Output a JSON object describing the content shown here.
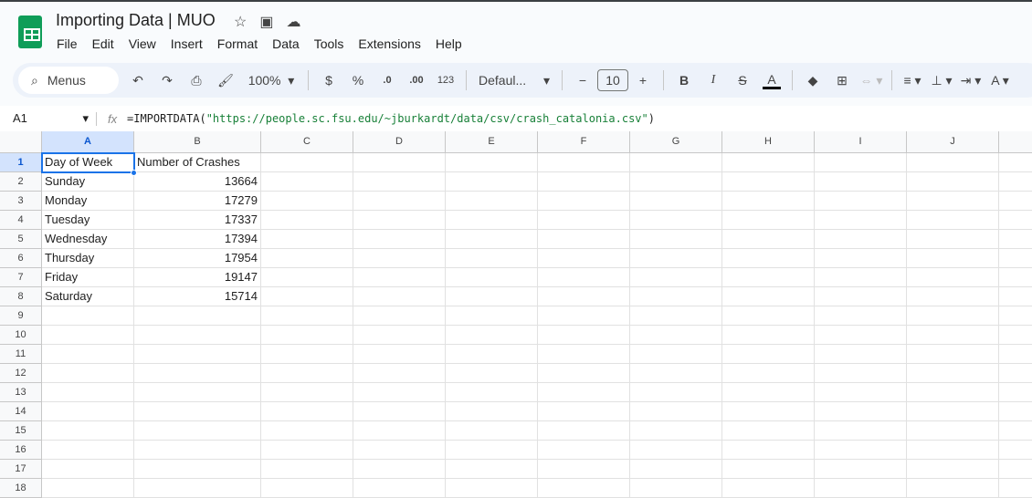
{
  "doc": {
    "title": "Importing Data | MUO"
  },
  "menu": [
    "File",
    "Edit",
    "View",
    "Insert",
    "Format",
    "Data",
    "Tools",
    "Extensions",
    "Help"
  ],
  "toolbar": {
    "search": "Menus",
    "zoom": "100%",
    "currency": "$",
    "percent": "%",
    "dec_decrease": ".0",
    "dec_increase": ".00",
    "number_format": "123",
    "font": "Defaul...",
    "font_size": "10"
  },
  "formula_bar": {
    "name_box": "A1",
    "fx": "fx",
    "formula_prefix": "=IMPORTDATA(",
    "formula_string": "\"https://people.sc.fsu.edu/~jburkardt/data/csv/crash_catalonia.csv\"",
    "formula_suffix": ")"
  },
  "columns": [
    "A",
    "B",
    "C",
    "D",
    "E",
    "F",
    "G",
    "H",
    "I",
    "J"
  ],
  "rows": [
    "1",
    "2",
    "3",
    "4",
    "5",
    "6",
    "7",
    "8",
    "9",
    "10",
    "11",
    "12",
    "13",
    "14",
    "15",
    "16",
    "17",
    "18"
  ],
  "table": {
    "header": [
      "Day of Week",
      "Number of Crashes"
    ],
    "data": [
      [
        "Sunday",
        "13664"
      ],
      [
        "Monday",
        "17279"
      ],
      [
        "Tuesday",
        "17337"
      ],
      [
        "Wednesday",
        "17394"
      ],
      [
        "Thursday",
        "17954"
      ],
      [
        "Friday",
        "19147"
      ],
      [
        "Saturday",
        "15714"
      ]
    ]
  },
  "colors": {
    "accent": "#1a73e8",
    "logo": "#0f9d58"
  }
}
